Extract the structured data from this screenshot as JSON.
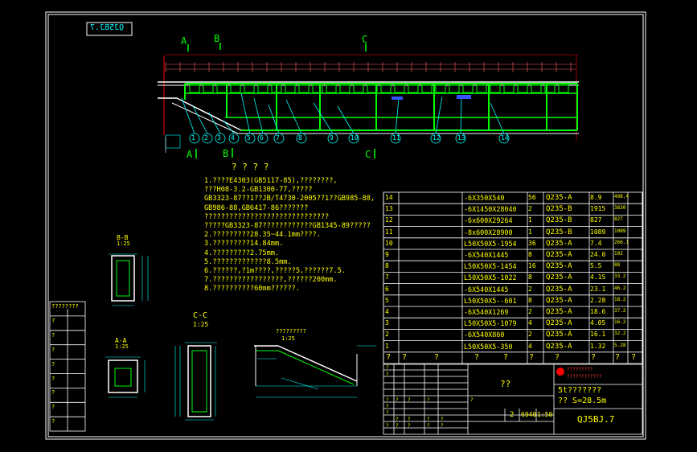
{
  "drawing": {
    "mirror_code": "QJ5BJ.7",
    "drawing_no": "QJ5BJ.7",
    "view_labels": {
      "A_top": "A",
      "B_top": "B",
      "C_top": "C",
      "A_bottom": "A",
      "B_bottom": "B",
      "C_bottom": "C"
    },
    "notes_title": "? ? ? ?",
    "notes": [
      "1.????E4303(GB5117-85),????????,",
      "  ???H08-3.2-GB1300-77,?????",
      "  GB3323-87??1??JB/T4730-2005??1??GB985-88,",
      "  GB986-88,GB6417-86???????",
      "  ??????????????????????????????",
      "  ?????GB3323-87????????????GB1345-89?????",
      "2.?????????28.35~44.1mm????.",
      "3.?????????14.84mm.",
      "4.?????????2.75mm.",
      "5.?????????????8.5mm.",
      "6.??????,?1m????,?????5,??????7.5.",
      "7.?????????????????,??????200mm.",
      "8.??????????60mm??????."
    ],
    "sections": {
      "bb": {
        "title": "B-B",
        "scale": "1:25"
      },
      "aa": {
        "title": "A-A",
        "scale": "1:25"
      },
      "cc": {
        "title": "C-C",
        "scale": "1:25"
      },
      "detail": {
        "title": "?????????",
        "scale": "1:25"
      }
    },
    "left_block": [
      "????????",
      "?",
      "?",
      "?",
      "?",
      "?",
      "?",
      "?",
      "?"
    ],
    "bom": [
      {
        "no": "14",
        "spec": "-6X350X540",
        "qty": "56",
        "mat": "Q235-A",
        "unit": "8.9",
        "total": "498.4"
      },
      {
        "no": "13",
        "spec": "-6X1450X28040",
        "qty": "2",
        "mat": "Q235-B",
        "unit": "1915",
        "total": "3830"
      },
      {
        "no": "12",
        "spec": "-6x600X29264",
        "qty": "1",
        "mat": "Q235-B",
        "unit": "827",
        "total": "827"
      },
      {
        "no": "11",
        "spec": "-8x600X28900",
        "qty": "1",
        "mat": "Q235-B",
        "unit": "1089",
        "total": "1089"
      },
      {
        "no": "10",
        "spec": "L50X50X5-1954",
        "qty": "36",
        "mat": "Q235-A",
        "unit": "7.4",
        "total": "266.1"
      },
      {
        "no": "9",
        "spec": "-6X540X1445",
        "qty": "8",
        "mat": "Q235-A",
        "unit": "24.0",
        "total": "192"
      },
      {
        "no": "8",
        "spec": "L50X50X5-1454",
        "qty": "16",
        "mat": "Q235-A",
        "unit": "5.5",
        "total": "88"
      },
      {
        "no": "7",
        "spec": "L50X50X5-1022",
        "qty": "8",
        "mat": "Q235-A",
        "unit": "4.15",
        "total": "33.2"
      },
      {
        "no": "6",
        "spec": "-6X540X1445",
        "qty": "2",
        "mat": "Q235-A",
        "unit": "23.1",
        "total": "46.2"
      },
      {
        "no": "5",
        "spec": "L50X50X5--601",
        "qty": "8",
        "mat": "Q235-A",
        "unit": "2.28",
        "total": "18.2"
      },
      {
        "no": "4",
        "spec": "-6X540X1269",
        "qty": "2",
        "mat": "Q235-A",
        "unit": "18.6",
        "total": "37.2"
      },
      {
        "no": "3",
        "spec": "L50X50X5-1079",
        "qty": "4",
        "mat": "Q235-A",
        "unit": "4.05",
        "total": "16.2"
      },
      {
        "no": "2",
        "spec": "-6X540X860",
        "qty": "2",
        "mat": "Q235-A",
        "unit": "16.1",
        "total": "32.2"
      },
      {
        "no": "1",
        "spec": "L50X50X5-350",
        "qty": "4",
        "mat": "Q235-A",
        "unit": "1.32",
        "total": "5.28"
      }
    ],
    "bom_header": [
      "?",
      "?",
      "?",
      "?",
      "?",
      "?",
      "?",
      "?",
      "?",
      "?"
    ],
    "title_block": {
      "name_center": "??",
      "company_line1": "?????????",
      "company_line2": "????????????",
      "product_line1": "5t???????",
      "product_line2": "?? S=28.5m",
      "sheet": "2",
      "weight": "6940",
      "scale": "1:50",
      "code": "QJ5BJ.7",
      "small_labels": [
        "?",
        "?",
        "?",
        "?",
        "?",
        "?",
        "?",
        "?",
        "?",
        "?",
        "?",
        "?",
        "?",
        "?",
        "?",
        "?",
        "?",
        "?"
      ]
    },
    "balloons": [
      "1",
      "2",
      "3",
      "4",
      "5",
      "6",
      "7",
      "8",
      "9",
      "10",
      "11",
      "12",
      "13",
      "14"
    ],
    "colors": {
      "background": "#000000",
      "frame": "#ffffff",
      "structure": "#00ff00",
      "annotation": "#00ffff",
      "text": "#ffff00",
      "dimension": "#ff0000"
    }
  }
}
